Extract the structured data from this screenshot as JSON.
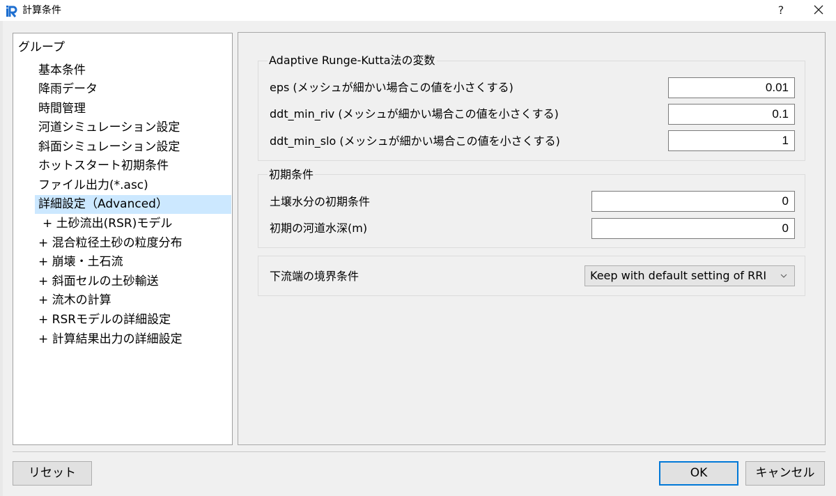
{
  "window": {
    "title": "計算条件",
    "help_label": "?",
    "close_icon": "close-icon",
    "app_icon": "iric-logo-icon"
  },
  "tree": {
    "header": "グループ",
    "items": [
      {
        "label": "基本条件"
      },
      {
        "label": "降雨データ"
      },
      {
        "label": "時間管理"
      },
      {
        "label": "河道シミュレーション設定"
      },
      {
        "label": "斜面シミュレーション設定"
      },
      {
        "label": "ホットスタート初期条件"
      },
      {
        "label": "ファイル出力(*.asc)"
      },
      {
        "label": "詳細設定（Advanced）",
        "selected": true
      },
      {
        "label": "+ 土砂流出(RSR)モデル"
      },
      {
        "label": "+ 混合粒径土砂の粒度分布"
      },
      {
        "label": "+ 崩壊・土石流"
      },
      {
        "label": "+ 斜面セルの土砂輸送"
      },
      {
        "label": "+ 流木の計算"
      },
      {
        "label": "+ RSRモデルの詳細設定"
      },
      {
        "label": "+ 計算結果出力の詳細設定"
      }
    ]
  },
  "groups": {
    "rk": {
      "title": "Adaptive Runge-Kutta法の変数",
      "fields": [
        {
          "label": "eps (メッシュが細かい場合この値を小さくする)",
          "value": "0.01"
        },
        {
          "label": "ddt_min_riv (メッシュが細かい場合この値を小さくする)",
          "value": "0.1"
        },
        {
          "label": "ddt_min_slo (メッシュが細かい場合この値を小さくする)",
          "value": "1"
        }
      ]
    },
    "initial": {
      "title": "初期条件",
      "fields": [
        {
          "label": "土壌水分の初期条件",
          "value": "0"
        },
        {
          "label": "初期の河道水深(m)",
          "value": "0"
        }
      ]
    },
    "boundary": {
      "label": "下流端の境界条件",
      "selected": "Keep with default setting of RRI",
      "arrow_icon": "chevron-down-icon"
    }
  },
  "buttons": {
    "reset": "リセット",
    "ok": "OK",
    "cancel": "キャンセル"
  },
  "colors": {
    "selection": "#cce8ff",
    "default_button_border": "#0078d7",
    "logo_blue": "#1e6fd0"
  }
}
